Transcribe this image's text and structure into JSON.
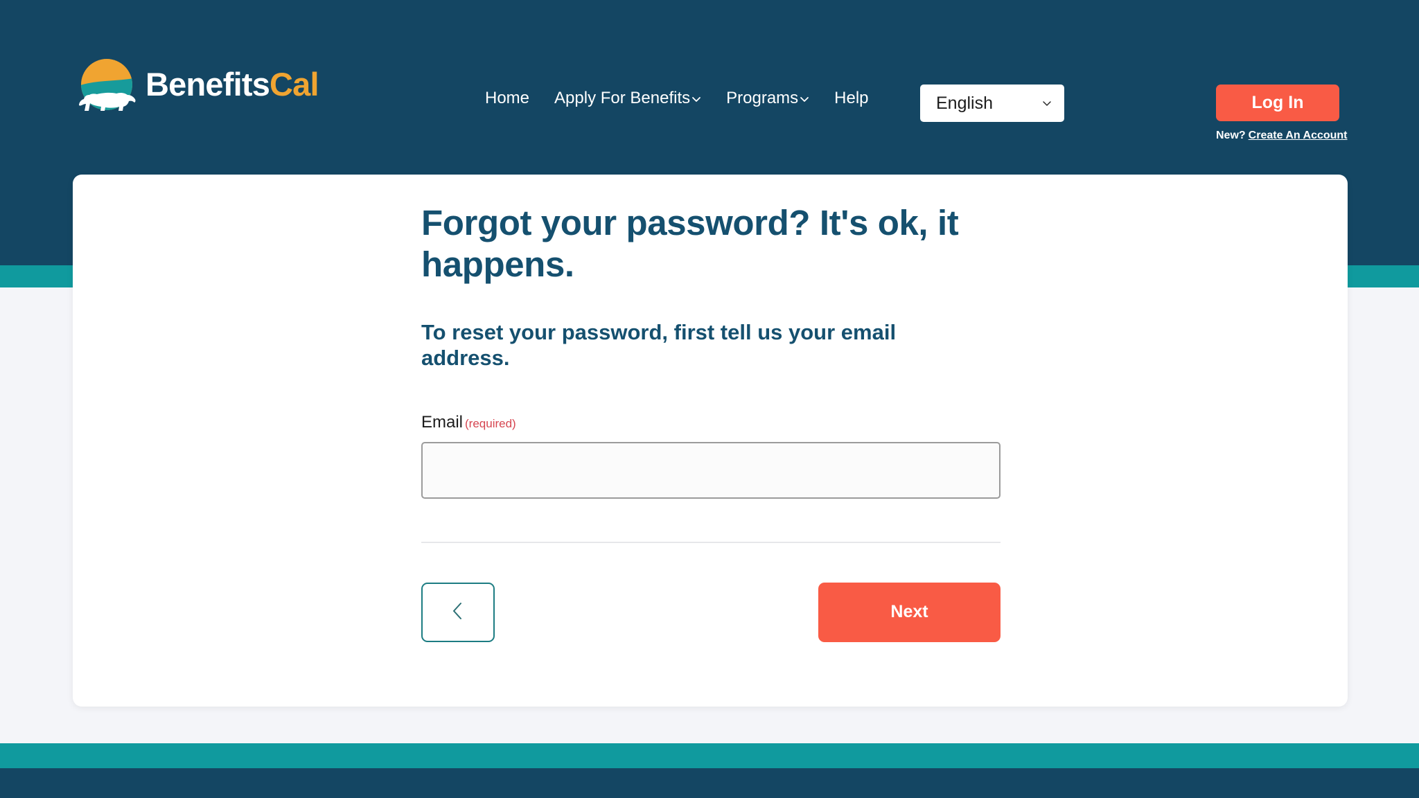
{
  "site": {
    "brand_primary": "Benefits",
    "brand_secondary": "Cal",
    "logo_icon": "bear-sun-logo-icon"
  },
  "colors": {
    "header_navy": "#144663",
    "teal_band": "#109a9e",
    "accent_orange": "#f95b45",
    "brand_gold": "#f0a431",
    "heading_blue": "#15506f",
    "required_red": "#d64550",
    "page_background": "#f4f5f9"
  },
  "nav": {
    "items": [
      {
        "label": "Home",
        "has_dropdown": false
      },
      {
        "label": "Apply For Benefits",
        "has_dropdown": true
      },
      {
        "label": "Programs",
        "has_dropdown": true
      },
      {
        "label": "Help",
        "has_dropdown": false
      }
    ]
  },
  "language_select": {
    "selected": "English",
    "caret_icon": "chevron-down-icon"
  },
  "account": {
    "login_label": "Log In",
    "new_prompt": "New?",
    "create_account_label": "Create An Account"
  },
  "main": {
    "title": "Forgot your password? It's ok, it happens.",
    "subtitle": "To reset your password, first tell us your email address.",
    "email": {
      "label": "Email",
      "required_note": "(required)",
      "value": "",
      "placeholder": ""
    }
  },
  "actions": {
    "back_icon": "chevron-left-icon",
    "next_label": "Next"
  }
}
